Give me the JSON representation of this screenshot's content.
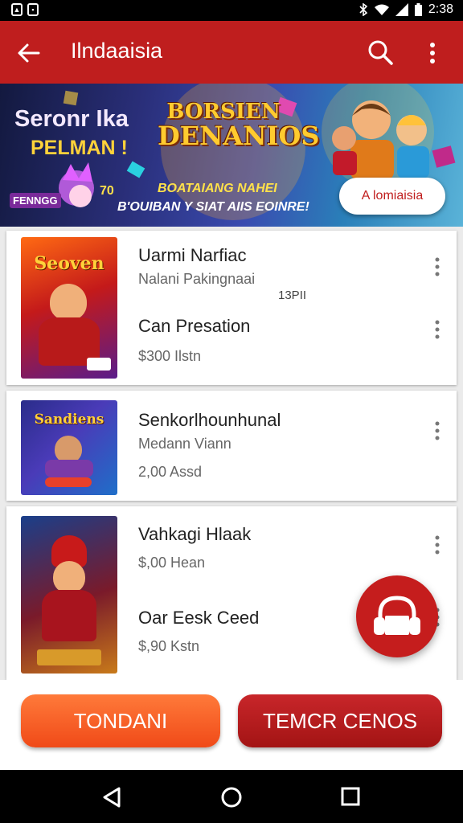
{
  "status_bar": {
    "time": "2:38"
  },
  "app_bar": {
    "title": "Ilndaaisia"
  },
  "banner": {
    "subtitle_line1": "Seronr Ika",
    "subtitle_line2": "PELMAN !",
    "brand_line1": "BORSIEN",
    "brand_line2": "DENANIOS",
    "tagline1": "BOATAIANG NAHEI",
    "tagline2": "B'OUIBAN Y SIAT AIIS EOINRE!",
    "small_logo": "FENNGG",
    "badge": "70",
    "cta_label": "A lomiaisia"
  },
  "cards": [
    {
      "thumb_title": "Seoven",
      "title": "Uarmi Narfiac",
      "subtitle": "Nalani Pakingnaai",
      "extra": "13PII",
      "title2": "Can Presation",
      "price": "$300 Ilstn"
    },
    {
      "thumb_title": "Sandiens",
      "title": "Senkorlhounhunal",
      "subtitle": "Medann Viann",
      "price": "2,00 Assd"
    },
    {
      "title": "Vahkagi Hlaak",
      "price": "$,00 Hean",
      "title2": "Oar Eesk Ceed",
      "price2": "$,90 Kstn"
    }
  ],
  "buttons": {
    "primary": "TONDANI",
    "secondary": "TEMCR CENOS"
  },
  "colors": {
    "app_bar": "#bf1e1e",
    "primary_button": "#f04a18",
    "secondary_button": "#a31414",
    "fab": "#c51d1d"
  },
  "icons": [
    "back-arrow-icon",
    "search-icon",
    "more-vert-icon",
    "headset-icon",
    "nav-back-icon",
    "nav-home-icon",
    "nav-recents-icon"
  ]
}
